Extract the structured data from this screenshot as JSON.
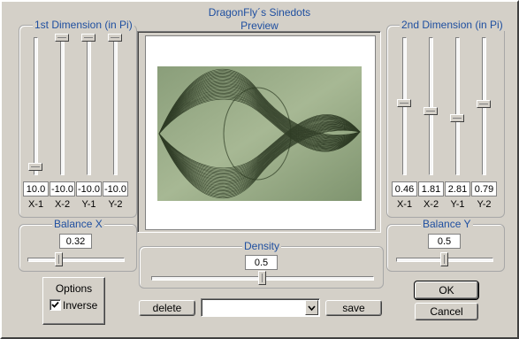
{
  "window": {
    "title": "DragonFly´s Sinedots"
  },
  "preview": {
    "label": "Preview"
  },
  "dim1": {
    "title": "1st Dimension (in Pi)",
    "sliders": [
      {
        "label": "X-1",
        "value": "10.0",
        "level": 0.05
      },
      {
        "label": "X-2",
        "value": "-10.0",
        "level": 1.0
      },
      {
        "label": "Y-1",
        "value": "-10.0",
        "level": 1.0
      },
      {
        "label": "Y-2",
        "value": "-10.0",
        "level": 1.0
      }
    ]
  },
  "dim2": {
    "title": "2nd Dimension (in Pi)",
    "sliders": [
      {
        "label": "X-1",
        "value": "0.46",
        "level": 0.52
      },
      {
        "label": "X-2",
        "value": "1.81",
        "level": 0.46
      },
      {
        "label": "Y-1",
        "value": "2.81",
        "level": 0.41
      },
      {
        "label": "Y-2",
        "value": "0.79",
        "level": 0.51
      }
    ]
  },
  "balance_x": {
    "title": "Balance X",
    "value": "0.32",
    "level": 0.32
  },
  "balance_y": {
    "title": "Balance Y",
    "value": "0.5",
    "level": 0.5
  },
  "density": {
    "title": "Density",
    "value": "0.5",
    "level": 0.5
  },
  "options": {
    "title": "Options",
    "inverse_label": "Inverse",
    "inverse_checked": true
  },
  "presets": {
    "delete_label": "delete",
    "save_label": "save",
    "selected": ""
  },
  "buttons": {
    "ok_label": "OK",
    "cancel_label": "Cancel"
  },
  "colors": {
    "title_blue": "#1f4fa0",
    "face": "#d4d0c8"
  }
}
